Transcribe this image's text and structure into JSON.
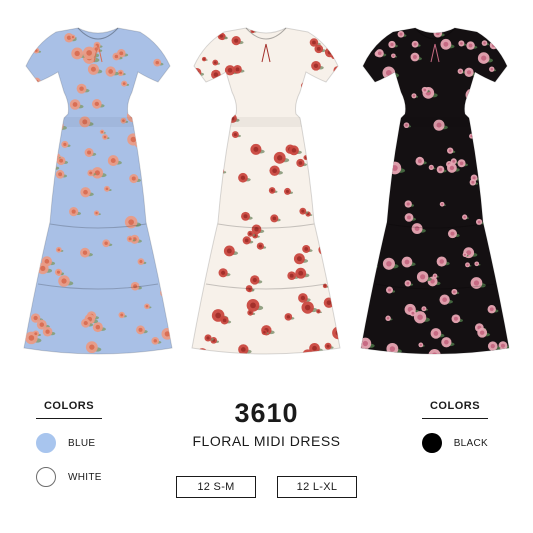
{
  "product": {
    "model_number": "3610",
    "name": "FLORAL MIDI DRESS"
  },
  "colors_left": {
    "title": "COLORS",
    "options": [
      {
        "label": "BLUE",
        "swatch": "#a8c5ee"
      },
      {
        "label": "WHITE",
        "swatch": "#ffffff"
      }
    ]
  },
  "colors_right": {
    "title": "COLORS",
    "options": [
      {
        "label": "BLACK",
        "swatch": "#000000"
      }
    ]
  },
  "sizes": [
    "12 S-M",
    "12 L-XL"
  ],
  "dresses": [
    {
      "base": "#a9c0e6",
      "flower": "#e99b86",
      "accent": "#d96f55",
      "leaf": "#7f9a6b"
    },
    {
      "base": "#f7f1ea",
      "flower": "#c9473f",
      "accent": "#a3302b",
      "leaf": "#7a8e6c"
    },
    {
      "base": "#141012",
      "flower": "#e8a6b4",
      "accent": "#c66a83",
      "leaf": "#4f7a4a"
    }
  ]
}
